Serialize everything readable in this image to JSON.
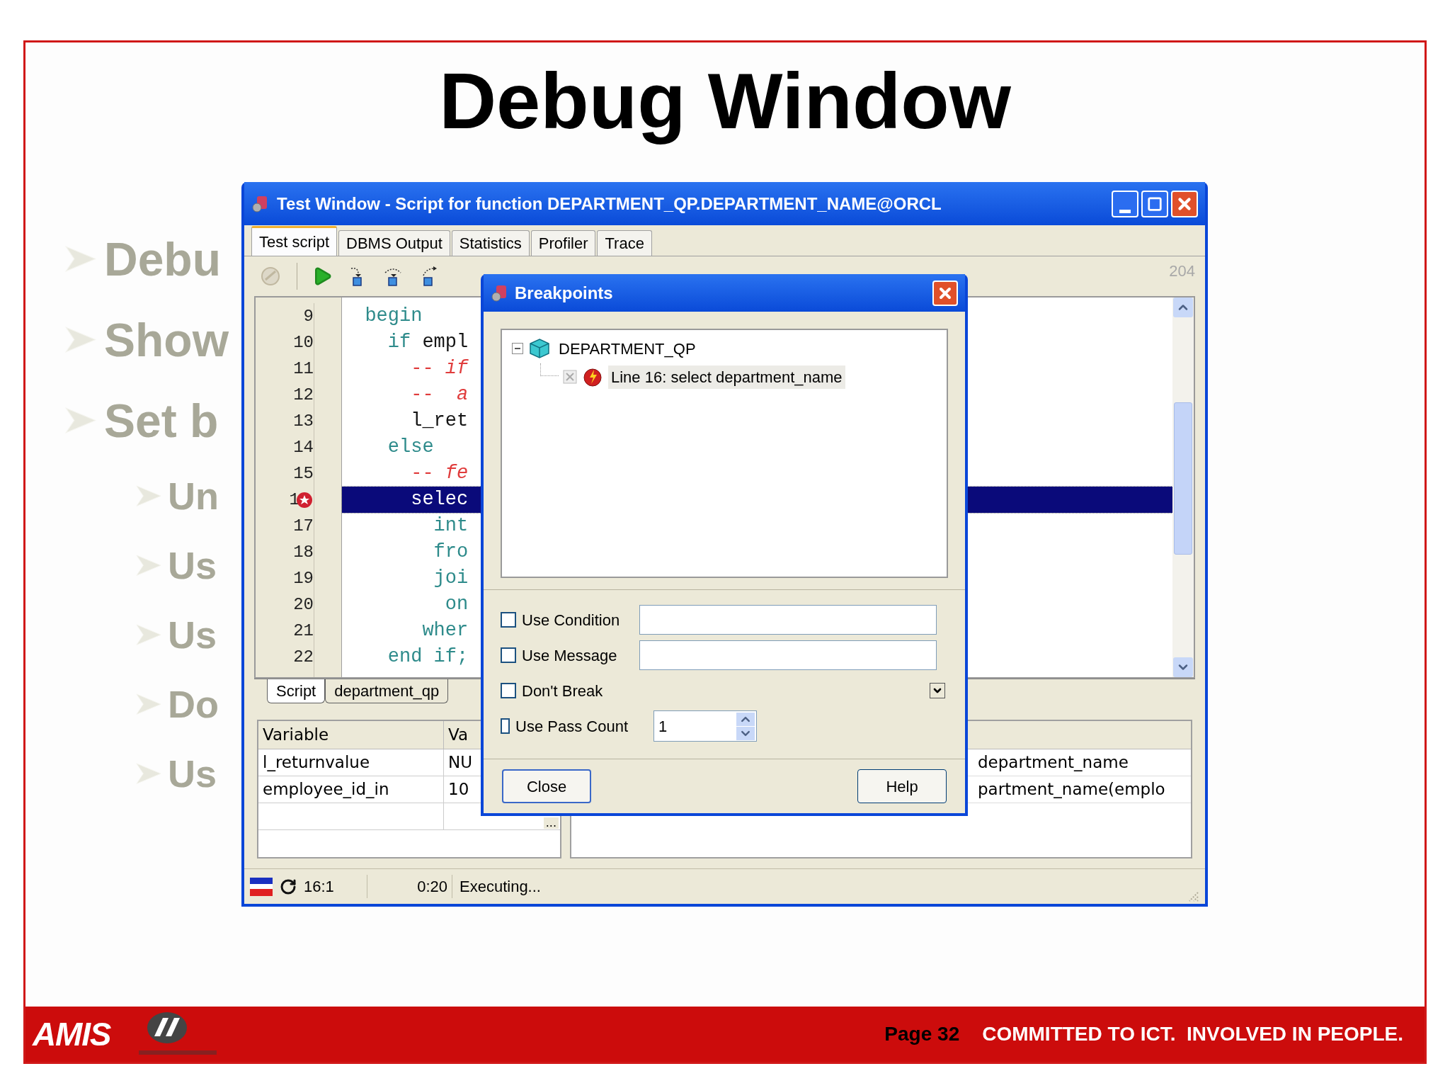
{
  "slide": {
    "title": "Debug Window",
    "bullets": [
      {
        "text": "Debu"
      },
      {
        "text": "Show"
      },
      {
        "text": "Set b",
        "children": [
          {
            "text": "Un"
          },
          {
            "text": "Us"
          },
          {
            "text": "Us"
          },
          {
            "text": "Do"
          },
          {
            "text": "Us"
          }
        ]
      }
    ]
  },
  "window": {
    "title": "Test Window - Script for function DEPARTMENT_QP.DEPARTMENT_NAME@ORCL",
    "tabs": [
      {
        "label": "Test script",
        "selected": true
      },
      {
        "label": "DBMS Output",
        "selected": false
      },
      {
        "label": "Statistics",
        "selected": false
      },
      {
        "label": "Profiler",
        "selected": false
      },
      {
        "label": "Trace",
        "selected": false
      }
    ],
    "toolbar": {
      "counter": "204"
    },
    "lines": [
      {
        "number": "9",
        "selected": false,
        "breakpoint": false,
        "tokens": [
          {
            "kind": "keyword",
            "text": "  begin"
          }
        ]
      },
      {
        "number": "10",
        "selected": false,
        "breakpoint": false,
        "tokens": [
          {
            "kind": "keyword",
            "text": "    if"
          },
          {
            "kind": "plain",
            "text": " empl"
          }
        ]
      },
      {
        "number": "11",
        "selected": false,
        "breakpoint": false,
        "tokens": [
          {
            "kind": "comment",
            "text": "      -- *if*"
          }
        ]
      },
      {
        "number": "12",
        "selected": false,
        "breakpoint": false,
        "tokens": [
          {
            "kind": "comment",
            "text": "      --  *a*"
          }
        ]
      },
      {
        "number": "13",
        "selected": false,
        "breakpoint": false,
        "tokens": [
          {
            "kind": "plain",
            "text": "      l_ret"
          }
        ]
      },
      {
        "number": "14",
        "selected": false,
        "breakpoint": false,
        "tokens": [
          {
            "kind": "keyword",
            "text": "    else"
          }
        ]
      },
      {
        "number": "15",
        "selected": false,
        "breakpoint": false,
        "tokens": [
          {
            "kind": "comment",
            "text": "      -- *fe*"
          }
        ]
      },
      {
        "number": "1",
        "selected": true,
        "breakpoint": true,
        "tokens": [
          {
            "kind": "keyword",
            "text": "      selec"
          }
        ]
      },
      {
        "number": "17",
        "selected": false,
        "breakpoint": false,
        "tokens": [
          {
            "kind": "keyword",
            "text": "        int"
          }
        ]
      },
      {
        "number": "18",
        "selected": false,
        "breakpoint": false,
        "tokens": [
          {
            "kind": "keyword",
            "text": "        fro"
          }
        ]
      },
      {
        "number": "19",
        "selected": false,
        "breakpoint": false,
        "tokens": [
          {
            "kind": "keyword",
            "text": "        joi"
          }
        ]
      },
      {
        "number": "20",
        "selected": false,
        "breakpoint": false,
        "tokens": [
          {
            "kind": "keyword",
            "text": "         on"
          }
        ]
      },
      {
        "number": "21",
        "selected": false,
        "breakpoint": false,
        "tokens": [
          {
            "kind": "keyword",
            "text": "       wher"
          }
        ]
      },
      {
        "number": "22",
        "selected": false,
        "breakpoint": false,
        "tokens": [
          {
            "kind": "keyword",
            "text": "    end if;"
          }
        ]
      }
    ],
    "editor_tabs": [
      {
        "label": "Script",
        "selected": true
      },
      {
        "label": "department_qp",
        "selected": false
      }
    ],
    "variables": {
      "columns": [
        "Variable",
        "Va"
      ],
      "rows": [
        [
          "l_returnvalue",
          "NU"
        ],
        [
          "employee_id_in",
          "10"
        ]
      ],
      "more_button": "..."
    },
    "output_rows": [
      "department_name",
      "partment_name(emplo"
    ],
    "status_bar": {
      "position": "16:1",
      "time": "0:20",
      "message": "Executing..."
    }
  },
  "dialog": {
    "title": "Breakpoints",
    "tree": [
      {
        "label": "DEPARTMENT_QP",
        "expanded": true,
        "selected": false,
        "children": [
          {
            "label": "Line 16: select department_name",
            "selected": true
          }
        ]
      }
    ],
    "options": [
      {
        "kind": "text",
        "label": "Use Condition",
        "checked": false
      },
      {
        "kind": "text",
        "label": "Use Message",
        "checked": false
      },
      {
        "kind": "dropdown",
        "label": "Don't Break",
        "checked": false
      },
      {
        "kind": "spinner",
        "label": "Use Pass Count",
        "checked": false,
        "value": "1"
      }
    ],
    "buttons": [
      "Close",
      "Help"
    ]
  },
  "footer": {
    "logo": "AMIS",
    "page": "Page 32",
    "slogan": "COMMITTED TO ICT.  INVOLVED IN PEOPLE."
  }
}
